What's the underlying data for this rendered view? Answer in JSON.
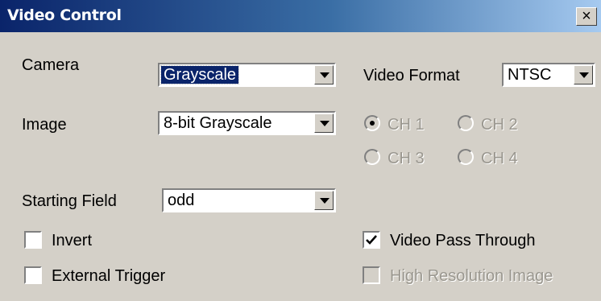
{
  "window": {
    "title": "Video Control",
    "close_label": "×"
  },
  "camera": {
    "label": "Camera",
    "value": "Grayscale"
  },
  "video_format": {
    "label": "Video Format",
    "value": "NTSC"
  },
  "image": {
    "label": "Image",
    "value": "8-bit Grayscale"
  },
  "channels": [
    {
      "label": "CH 1",
      "selected": true,
      "enabled": false
    },
    {
      "label": "CH 2",
      "selected": false,
      "enabled": false
    },
    {
      "label": "CH 3",
      "selected": false,
      "enabled": false
    },
    {
      "label": "CH 4",
      "selected": false,
      "enabled": false
    }
  ],
  "starting_field": {
    "label": "Starting Field",
    "value": "odd"
  },
  "invert": {
    "label": "Invert",
    "checked": false
  },
  "external_trigger": {
    "label": "External Trigger",
    "checked": false
  },
  "video_pass_through": {
    "label": "Video Pass Through",
    "checked": true
  },
  "high_resolution_image": {
    "label": "High Resolution Image",
    "checked": false,
    "enabled": false
  },
  "colors": {
    "title_start": "#0a246a",
    "title_end": "#a6caf0",
    "face": "#d4d0c8",
    "selection": "#0a246a"
  }
}
